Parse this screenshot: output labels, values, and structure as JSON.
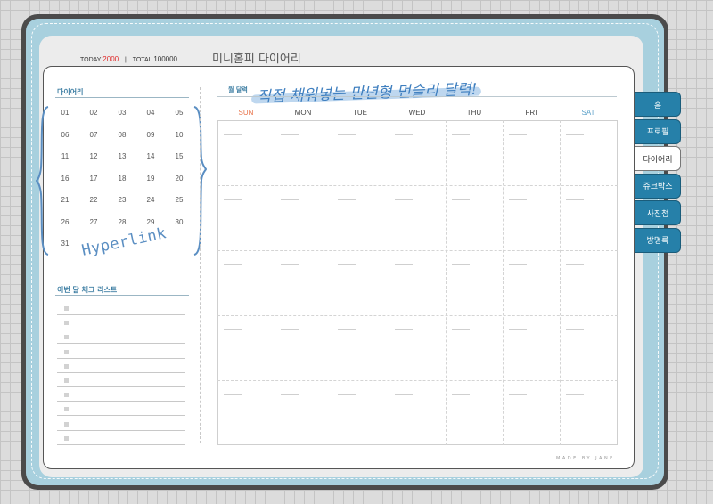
{
  "header": {
    "today_label": "TODAY",
    "today_count": "2000",
    "divider": "|",
    "total_label": "TOTAL",
    "total_count": "100000",
    "title": "미니홈피 다이어리"
  },
  "left": {
    "diary_label": "다이어리",
    "days": [
      "01",
      "02",
      "03",
      "04",
      "05",
      "06",
      "07",
      "08",
      "09",
      "10",
      "11",
      "12",
      "13",
      "14",
      "15",
      "16",
      "17",
      "18",
      "19",
      "20",
      "21",
      "22",
      "23",
      "24",
      "25",
      "26",
      "27",
      "28",
      "29",
      "30",
      "31"
    ],
    "hyperlink_text": "Hyperlink",
    "checklist_label": "이번 달 체크 리스트",
    "checklist_count": 10
  },
  "calendar": {
    "heading_label": "월 달력",
    "handwritten": "직접 채워넣는 만년형 먼슬리 달력!",
    "weekdays": [
      "SUN",
      "MON",
      "TUE",
      "WED",
      "THU",
      "FRI",
      "SAT"
    ],
    "weekday_colors": {
      "SUN": "#e8734a",
      "SAT": "#5aa0c8",
      "default": "#444444"
    },
    "rows": 5
  },
  "footer": {
    "made_by": "MADE BY JANE"
  },
  "tabs": [
    {
      "label": "홈",
      "active": false
    },
    {
      "label": "프로필",
      "active": false
    },
    {
      "label": "다이어리",
      "active": true
    },
    {
      "label": "쥬크박스",
      "active": false
    },
    {
      "label": "사진첩",
      "active": false
    },
    {
      "label": "방명록",
      "active": false
    }
  ],
  "colors": {
    "accent": "#2680a9",
    "frame_blue": "#a8d0de",
    "brace": "#5a8ec2"
  }
}
